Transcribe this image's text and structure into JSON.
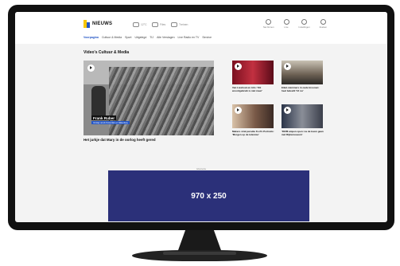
{
  "header": {
    "logo_text": "NIEUWS",
    "weather": [
      {
        "icon": "cloud-icon",
        "text": "12°C"
      },
      {
        "icon": "car-icon",
        "text": "Files"
      },
      {
        "icon": "trein-icon",
        "text": "Treinen"
      }
    ],
    "tools": [
      {
        "icon": "clock-icon",
        "label": "Net binnen"
      },
      {
        "icon": "radio-icon",
        "label": "Live"
      },
      {
        "icon": "gear-icon",
        "label": "Instellingen"
      },
      {
        "icon": "search-icon",
        "label": "Zoeken"
      }
    ],
    "nav": [
      "Voorpagina",
      "Cultuur & Media",
      "Sport",
      "Uitgelegd",
      "TIJ",
      "Alle Verslagen",
      "Live Radio en TV",
      "Service"
    ],
    "nav_active": "Voorpagina"
  },
  "section": {
    "title": "Video's Cultuur & Media"
  },
  "main_video": {
    "caption_name": "Frank Ruber",
    "caption_sub": "Verslag vanuit Amsterdam en Valkenburg",
    "headline": "Het jurkje dat Mary in de oorlog heeft gered"
  },
  "thumbs": [
    {
      "caption": "Van Lieshout en Arts: 'Dit woordgebruik is niet meer'"
    },
    {
      "caption": "Eikel-stemmers in oude kroonen: heel beleefd '12 nu'"
    },
    {
      "caption": "Makers viral parodie Fo-Po Portraits: 'Morgen op de televisie'"
    },
    {
      "caption": "'RIVM ampen open: na de leven gaan met Rijksmuseum'"
    }
  ],
  "ad": {
    "label": "Advertentie",
    "size_text": "970 x 250"
  },
  "colors": {
    "accent": "#2355c5",
    "logo_yellow": "#f7c600",
    "ad_bg": "#2b3079"
  }
}
